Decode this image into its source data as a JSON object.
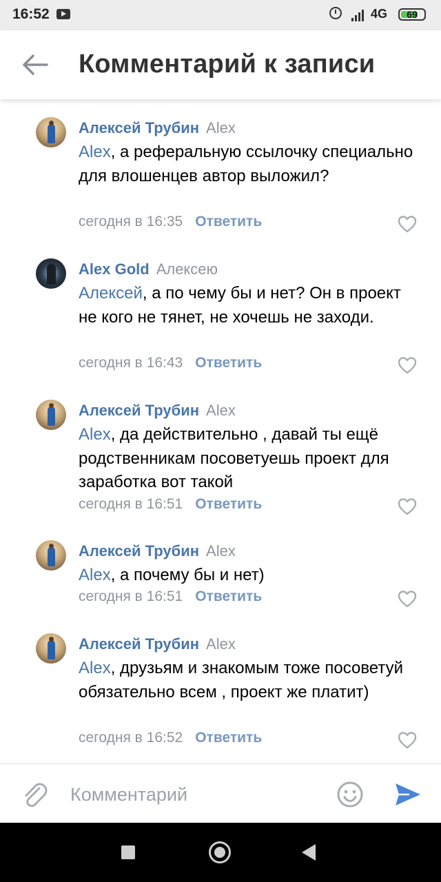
{
  "status_bar": {
    "time": "16:52",
    "network": "4G",
    "battery": "69"
  },
  "header": {
    "title": "Комментарий к записи"
  },
  "comments": [
    {
      "author": "Алексей Трубин",
      "reply_to": "Alex",
      "mention": "Alex",
      "text": ", а реферальную ссылочку специально для влошенцев автор выложил?",
      "time": "сегодня в 16:35",
      "reply_label": "Ответить"
    },
    {
      "author": "Alex Gold",
      "reply_to": "Алексею",
      "mention": "Алексей",
      "text": ", а по чему бы и нет? Он в проект не кого не тянет, не хочешь не заходи.",
      "time": "сегодня в 16:43",
      "reply_label": "Ответить"
    },
    {
      "author": "Алексей Трубин",
      "reply_to": "Alex",
      "mention": "Alex",
      "text": ", да действительно , давай ты ещё родственникам посоветуешь проект для заработка вот такой",
      "time": "сегодня в 16:51",
      "reply_label": "Ответить"
    },
    {
      "author": "Алексей Трубин",
      "reply_to": "Alex",
      "mention": "Alex",
      "text": ", а почему бы и нет)",
      "time": "сегодня в 16:51",
      "reply_label": "Ответить"
    },
    {
      "author": "Алексей Трубин",
      "reply_to": "Alex",
      "mention": "Alex",
      "text": ", друзьям и знакомым тоже посоветуй обязательно всем , проект же платит)",
      "time": "сегодня в 16:52",
      "reply_label": "Ответить"
    }
  ],
  "input_bar": {
    "placeholder": "Комментарий"
  },
  "colors": {
    "accent": "#4a76a8",
    "secondary_text": "#909499",
    "send": "#4a86d6"
  },
  "icons": [
    "back-arrow-icon",
    "attach-icon",
    "emoji-icon",
    "send-icon",
    "heart-icon"
  ]
}
